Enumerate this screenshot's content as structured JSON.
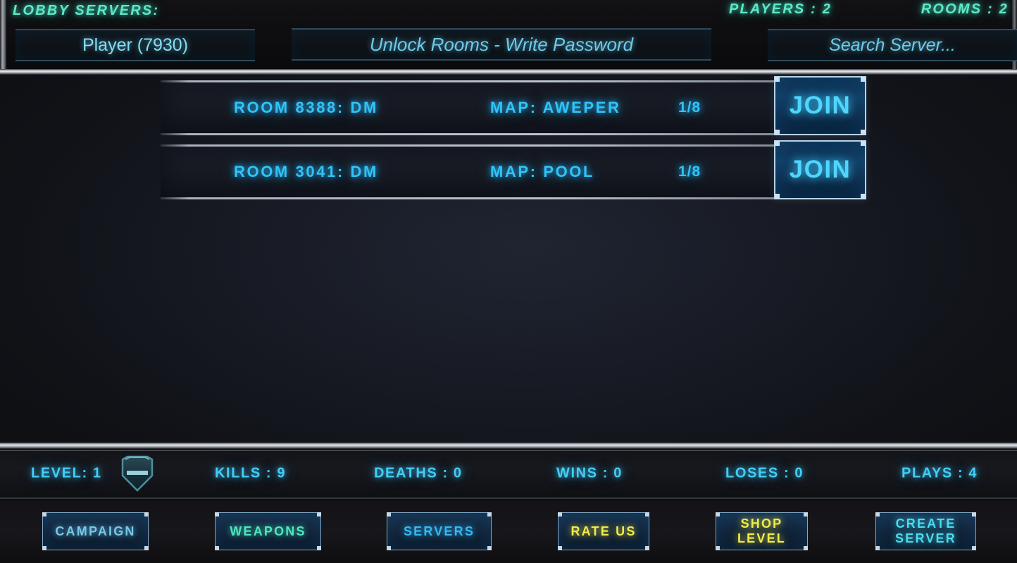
{
  "header": {
    "lobby_title": "LOBBY SERVERS:",
    "players_stat": "PLAYERS : 2",
    "rooms_stat": "ROOMS : 2",
    "player_field_value": "Player (7930)",
    "password_field_placeholder": "Unlock Rooms - Write Password",
    "search_field_placeholder": "Search  Server...",
    "accent_color": "#5fe8c8"
  },
  "rooms": [
    {
      "name": "ROOM 8388: DM",
      "map": "MAP: AWEPER",
      "capacity": "1/8",
      "join_label": "JOIN"
    },
    {
      "name": "ROOM 3041: DM",
      "map": "MAP: POOL",
      "capacity": "1/8",
      "join_label": "JOIN"
    }
  ],
  "stats": {
    "level": "LEVEL: 1",
    "kills": "KILLS : 9",
    "deaths": "DEATHS : 0",
    "wins": "WINS : 0",
    "loses": "LOSES : 0",
    "plays": "PLAYS : 4",
    "rank_badge_icon": "shield-rank-icon"
  },
  "nav": {
    "campaign": "CAMPAIGN",
    "weapons": "WEAPONS",
    "servers": "SERVERS",
    "rate_us": "RATE US",
    "shop_level": "SHOP\nLEVEL",
    "create_server": "CREATE\nSERVER",
    "colors": {
      "campaign": "#74c8ea",
      "weapons": "#4ce8bd",
      "servers": "#35b9f3",
      "rate_us": "#f2ec4a",
      "shop_level": "#f2ec4a",
      "create_server": "#49dbf0"
    }
  }
}
